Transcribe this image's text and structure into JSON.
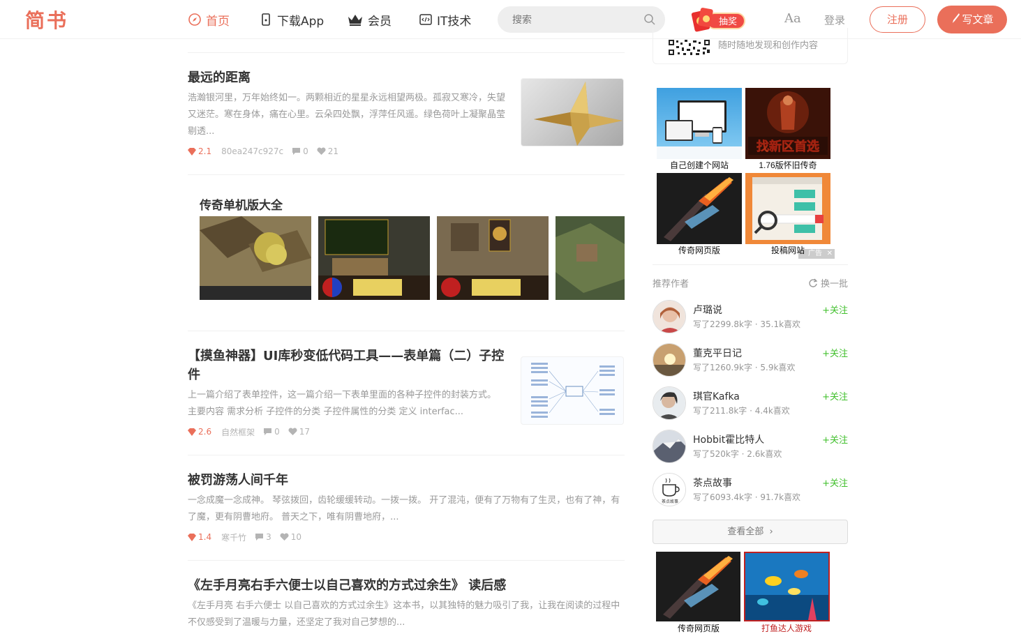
{
  "header": {
    "logo": "简书",
    "nav": [
      {
        "label": "首页",
        "icon": "compass-icon"
      },
      {
        "label": "下载App",
        "icon": "phone-icon"
      },
      {
        "label": "会员",
        "icon": "crown-icon"
      },
      {
        "label": "IT技术",
        "icon": "code-icon"
      }
    ],
    "search_placeholder": "搜索",
    "lottery_label": "抽奖",
    "font_toggle": "Aa",
    "login": "登录",
    "signup": "注册",
    "write": "写文章",
    "accent_color": "#ea6f5a"
  },
  "articles": [
    {
      "title": "最远的距离",
      "abstract": "浩瀚银河里，万年始终如一。两颗相近的星星永远相望两极。孤寂又寒冷，失望又迷茫。寒在身体，痛在心里。云朵四处飘，浮萍任风遥。绿色荷叶上凝聚晶莹剔透...",
      "diamond": "2.1",
      "author": "80ea247c927c",
      "comments": "0",
      "likes": "21"
    },
    {
      "title": "【摸鱼神器】UI库秒变低代码工具——表单篇（二）子控件",
      "abstract": "上一篇介绍了表单控件，这一篇介绍一下表单里面的各种子控件的封装方式。 主要内容 需求分析 子控件的分类 子控件属性的分类 定义 interfac...",
      "diamond": "2.6",
      "author": "自然框架",
      "comments": "0",
      "likes": "17"
    },
    {
      "title": "被罚游荡人间千年",
      "abstract": "一念成魔一念成神。 琴弦拨回，齿轮缓缓转动。一拨一拨。 开了混沌，便有了万物有了生灵，也有了神，有了魔，更有阴曹地府。 普天之下，唯有阴曹地府，...",
      "diamond": "1.4",
      "author": "寒千竹",
      "comments": "3",
      "likes": "10"
    },
    {
      "title": "《左手月亮右手六便士以自己喜欢的方式过余生》 读后感",
      "abstract": "《左手月亮 右手六便士 以自己喜欢的方式过余生》这本书，以其独特的魅力吸引了我，让我在阅读的过程中不仅感受到了温暖与力量，还坚定了我对自己梦想的..."
    }
  ],
  "ad_block": {
    "title": "传奇单机版大全"
  },
  "sidebar": {
    "qr_text": "随时随地发现和创作内容",
    "ads": [
      {
        "label": "自己创建个网站"
      },
      {
        "label": "1.76版怀旧传奇"
      },
      {
        "label": "传奇网页版"
      },
      {
        "label": "投稿网站"
      }
    ],
    "ad_tag": "广告",
    "ad_promo_text": "找新区首选",
    "recommend_title": "推荐作者",
    "refresh_label": "换一批",
    "authors": [
      {
        "name": "卢璐说",
        "stat": "写了2299.8k字 · 35.1k喜欢",
        "follow": "+关注"
      },
      {
        "name": "董克平日记",
        "stat": "写了1260.9k字 · 5.9k喜欢",
        "follow": "+关注"
      },
      {
        "name": "琪官Kafka",
        "stat": "写了211.8k字 · 4.4k喜欢",
        "follow": "+关注"
      },
      {
        "name": "Hobbit霍比特人",
        "stat": "写了520k字 · 2.6k喜欢",
        "follow": "+关注"
      },
      {
        "name": "茶点故事",
        "stat": "写了6093.4k字 · 91.7k喜欢",
        "follow": "+关注"
      }
    ],
    "avatar_tea_text": "茶点故事",
    "view_all": "查看全部",
    "bottom_ads": [
      {
        "label": "传奇网页版"
      },
      {
        "label": "打鱼达人游戏"
      }
    ]
  }
}
